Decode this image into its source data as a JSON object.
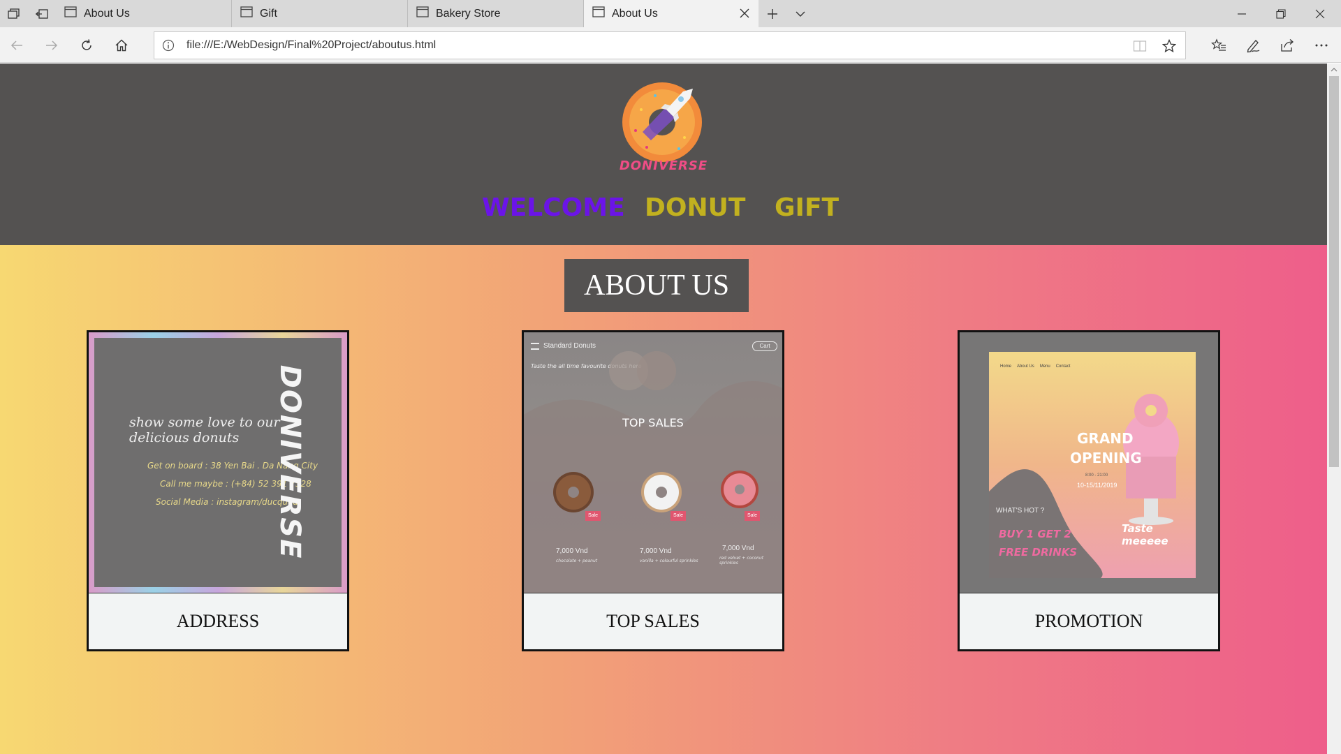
{
  "browser": {
    "tabs": [
      {
        "title": "About Us",
        "active": false
      },
      {
        "title": "Gift",
        "active": false
      },
      {
        "title": "Bakery Store",
        "active": false
      },
      {
        "title": "About Us",
        "active": true
      }
    ],
    "url": "file:///E:/WebDesign/Final%20Project/aboutus.html"
  },
  "site": {
    "logo_text": "DONIVERSE",
    "menu": {
      "welcome": "WELCOME",
      "donut": "DONUT",
      "gift": "GIFT"
    },
    "menu_colors": {
      "welcome": "#6b14e8",
      "donut": "#c2b11f",
      "gift": "#c2b11f"
    }
  },
  "page": {
    "title": "ABOUT US",
    "cards": [
      {
        "label": "ADDRESS",
        "image": {
          "brand": "DONIVERSE",
          "tagline": "show some love to our delicious donuts",
          "lines": [
            "Get on board : 38 Yen Bai . Da Nang City",
            "Call me maybe : (+84) 52 391 7528",
            "Social Media : instagram/ducquoa"
          ]
        }
      },
      {
        "label": "TOP SALES",
        "image": {
          "nav_title": "Standard Donuts",
          "cart": "Cart",
          "heading": "TOP SALES",
          "subtitle": "Taste the all time favourite donuts here",
          "sale_badge": "Sale",
          "items": [
            {
              "price": "7,000 Vnd",
              "desc": "chocolate + peanut"
            },
            {
              "price": "7,000 Vnd",
              "desc": "vanilla + colourful sprinkles"
            },
            {
              "price": "7,000 Vnd",
              "desc": "red velvet + coconut sprinkles"
            }
          ]
        }
      },
      {
        "label": "PROMOTION",
        "image": {
          "nav": [
            "Home",
            "About Us",
            "Menu",
            "Contact"
          ],
          "headline_1": "GRAND",
          "headline_2": "OPENING",
          "hours": "8:00 - 21:00",
          "dates": "10-15/11/2019",
          "whats_hot": "WHAT'S HOT ?",
          "offer_1": "BUY 1 GET 2",
          "offer_2": "FREE DRINKS",
          "cake_caption": "Taste meeeee"
        }
      }
    ]
  }
}
